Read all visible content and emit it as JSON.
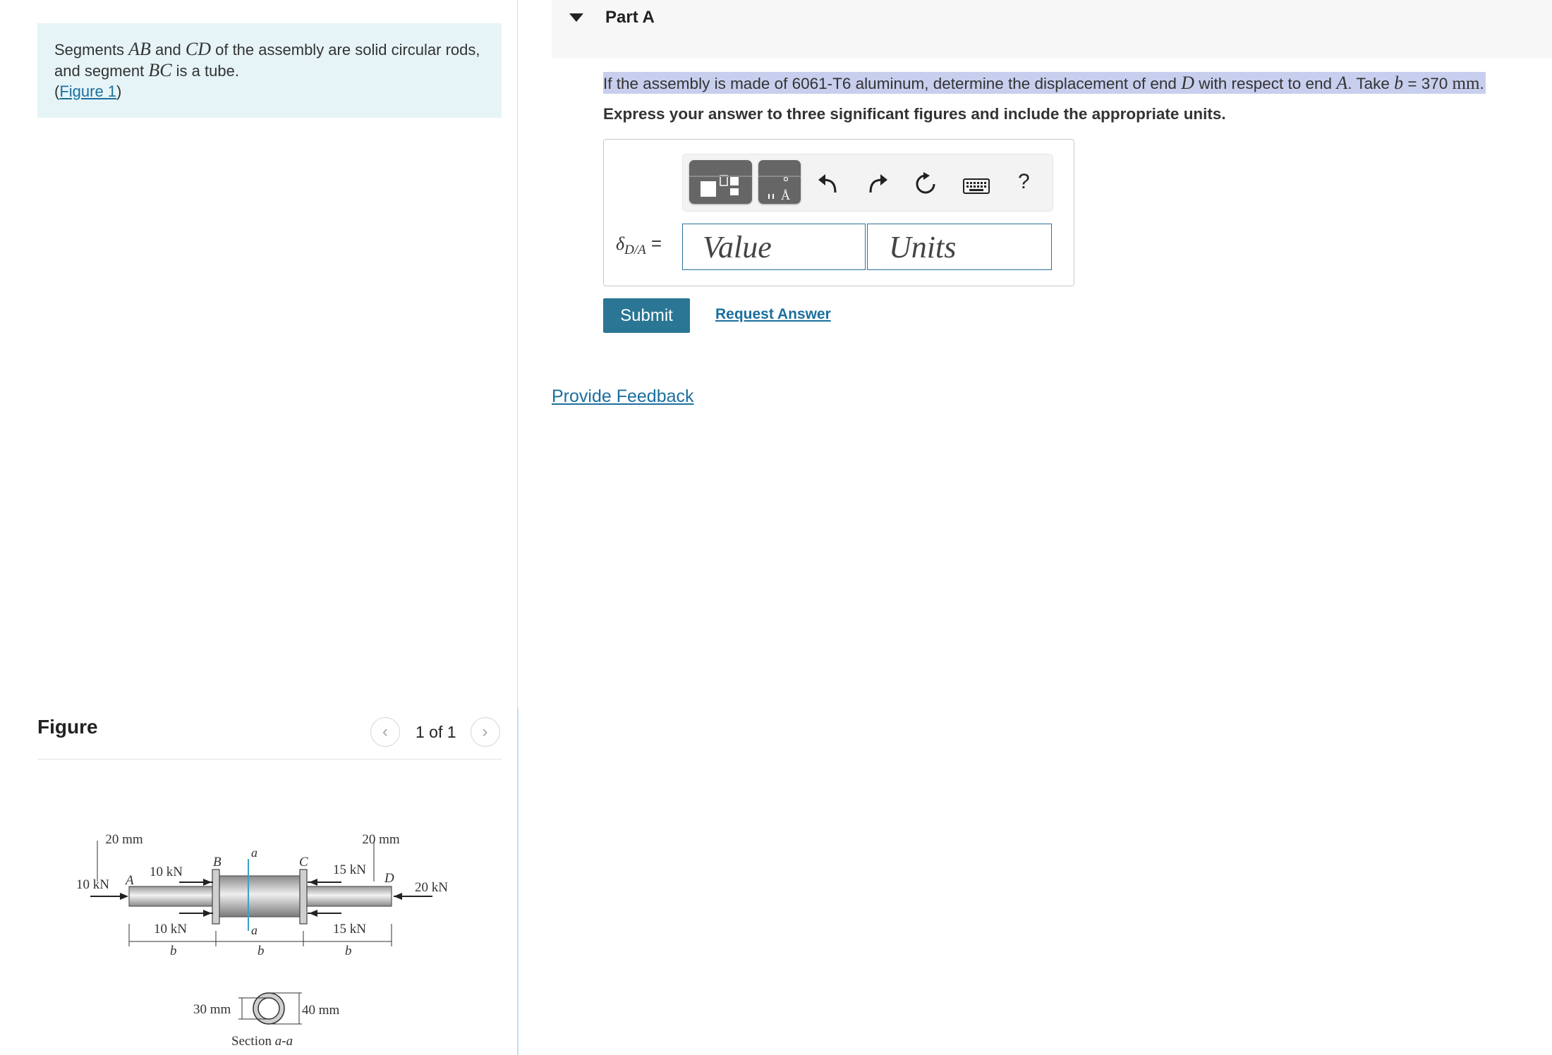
{
  "problem": {
    "text_1": "Segments ",
    "seg1": "AB",
    "text_2": " and ",
    "seg2": "CD",
    "text_3": " of the assembly are solid circular rods, and segment ",
    "seg3": "BC",
    "text_4": " is a tube.",
    "figure_open": "(",
    "figure_link": "Figure 1",
    "figure_close": ")"
  },
  "figure_panel": {
    "heading": "Figure",
    "counter": "1 of 1",
    "prev_symbol": "‹",
    "next_symbol": "›",
    "labels": {
      "dim_left": "20 mm",
      "dim_right": "20 mm",
      "force_left_outer": "10 kN",
      "force_ab_top": "10 kN",
      "force_ab_bottom": "10 kN",
      "force_cd_top": "15 kN",
      "force_cd_bottom": "15 kN",
      "force_right": "20 kN",
      "point_a": "A",
      "point_b": "B",
      "point_c": "C",
      "point_d": "D",
      "section_mark_top": "a",
      "section_mark_bottom": "a",
      "length_1": "b",
      "length_2": "b",
      "length_3": "b",
      "inner_dim": "30 mm",
      "outer_dim": "40 mm",
      "section_caption_prefix": "Section ",
      "section_caption_name": "a-a"
    }
  },
  "part": {
    "title": "Part A",
    "question": {
      "t1": "If the assembly is made of 6061-T6 aluminum, determine the displacement of end ",
      "end_d": "D",
      "t2": " with respect to end ",
      "end_a": "A",
      "t3": ". Take ",
      "var_b": "b",
      "t4": " = 370 ",
      "unit": "mm",
      "t5": "."
    },
    "instruction": "Express your answer to three significant figures and include the appropriate units.",
    "answer": {
      "delta_symbol": "δ",
      "delta_sub": "D/A",
      "equals": " =",
      "value_placeholder": "Value",
      "units_placeholder": "Units",
      "value": "",
      "units": ""
    },
    "toolbar": {
      "help_label": "?",
      "template_icon": "fraction-template-icon",
      "units_icon": "units-template-icon",
      "undo_icon": "undo-icon",
      "redo_icon": "redo-icon",
      "reset_icon": "reset-icon",
      "keyboard_icon": "keyboard-icon"
    },
    "submit_label": "Submit",
    "request_answer_label": "Request Answer"
  },
  "feedback_label": "Provide Feedback",
  "colors": {
    "problem_bg": "#e6f4f7",
    "link": "#1b6f9e",
    "submit_bg": "#2a7694",
    "input_border": "#2d6f9c",
    "question_highlight": "#c8cfee"
  }
}
